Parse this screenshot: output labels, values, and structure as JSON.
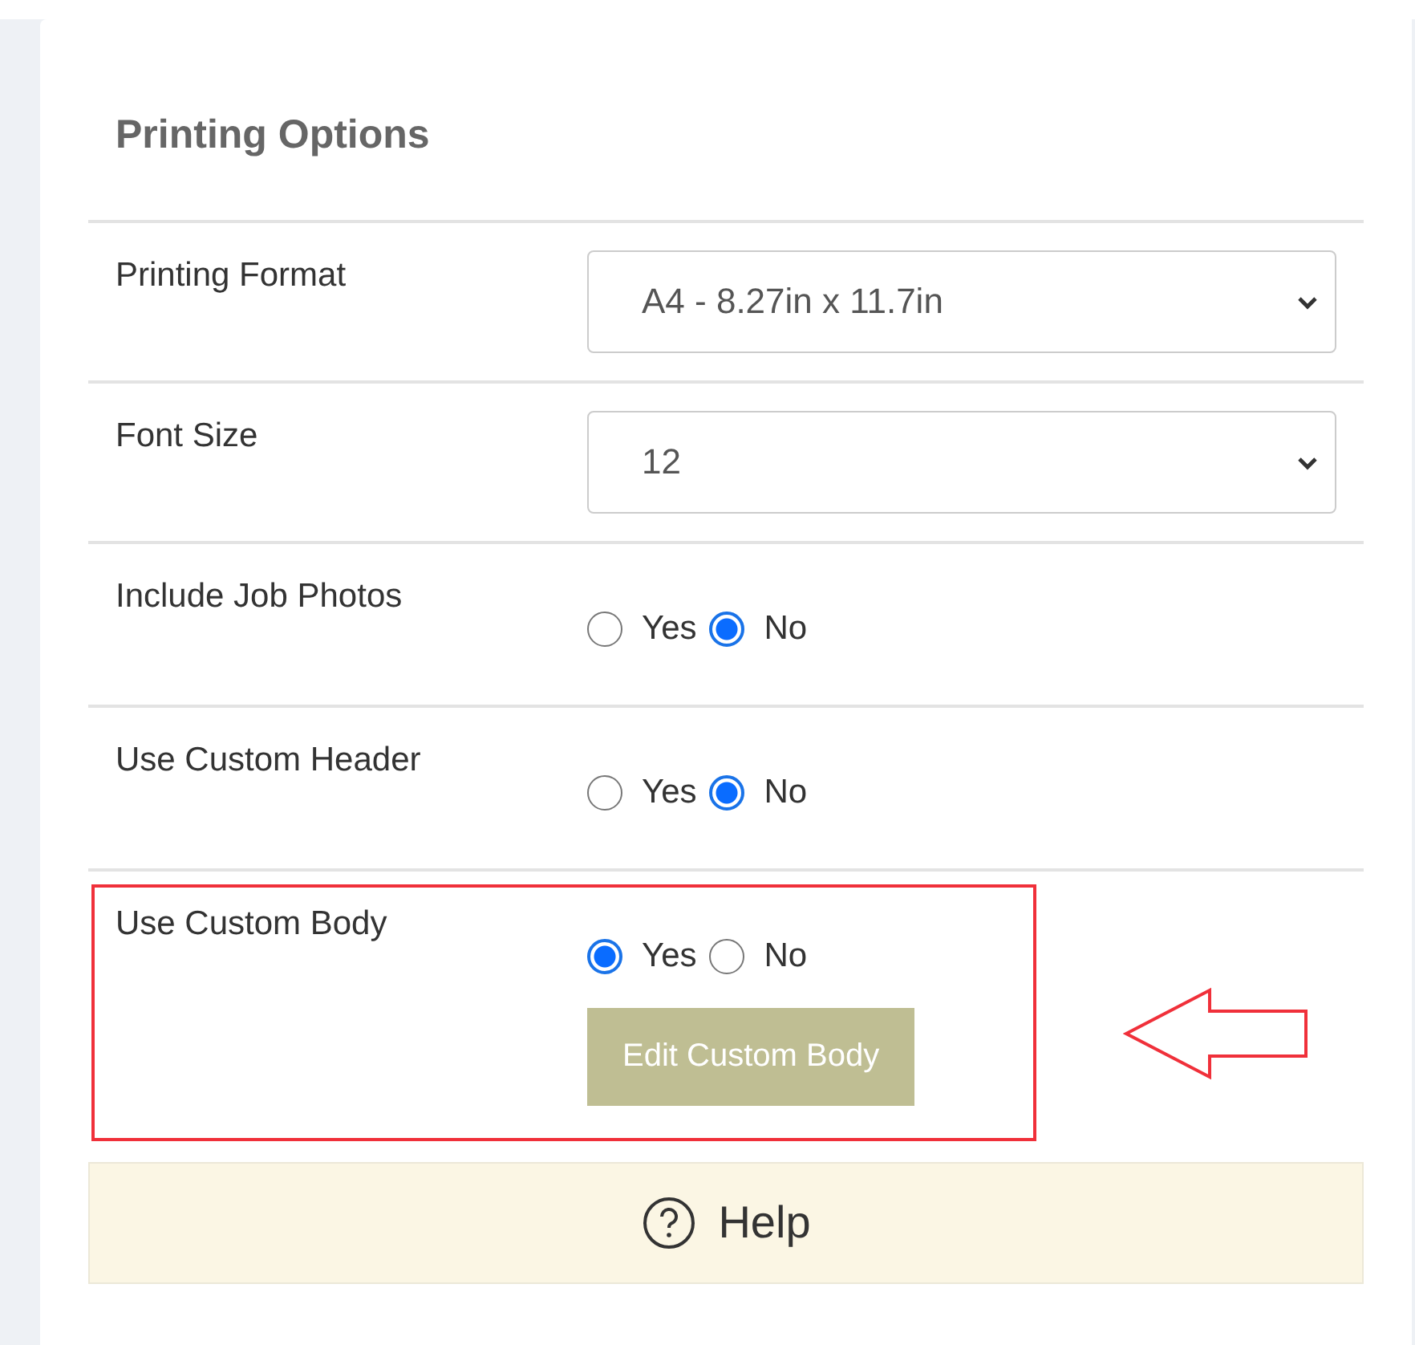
{
  "title": "Printing Options",
  "rows": [
    {
      "kind": "select",
      "label": "Printing Format",
      "value": "A4 - 8.27in x 11.7in",
      "highlighted": false
    },
    {
      "kind": "select",
      "label": "Font Size",
      "value": "12",
      "highlighted": false
    },
    {
      "kind": "radio",
      "label": "Include Job Photos",
      "options": [
        {
          "label": "Yes",
          "selected": false
        },
        {
          "label": "No",
          "selected": true
        }
      ],
      "highlighted": false
    },
    {
      "kind": "radio",
      "label": "Use Custom Header",
      "options": [
        {
          "label": "Yes",
          "selected": false
        },
        {
          "label": "No",
          "selected": true
        }
      ],
      "highlighted": false
    },
    {
      "kind": "radio",
      "label": "Use Custom Body",
      "options": [
        {
          "label": "Yes",
          "selected": true
        },
        {
          "label": "No",
          "selected": false
        }
      ],
      "button": "Edit Custom Body",
      "highlighted": true
    }
  ],
  "help": {
    "label": "Help"
  }
}
